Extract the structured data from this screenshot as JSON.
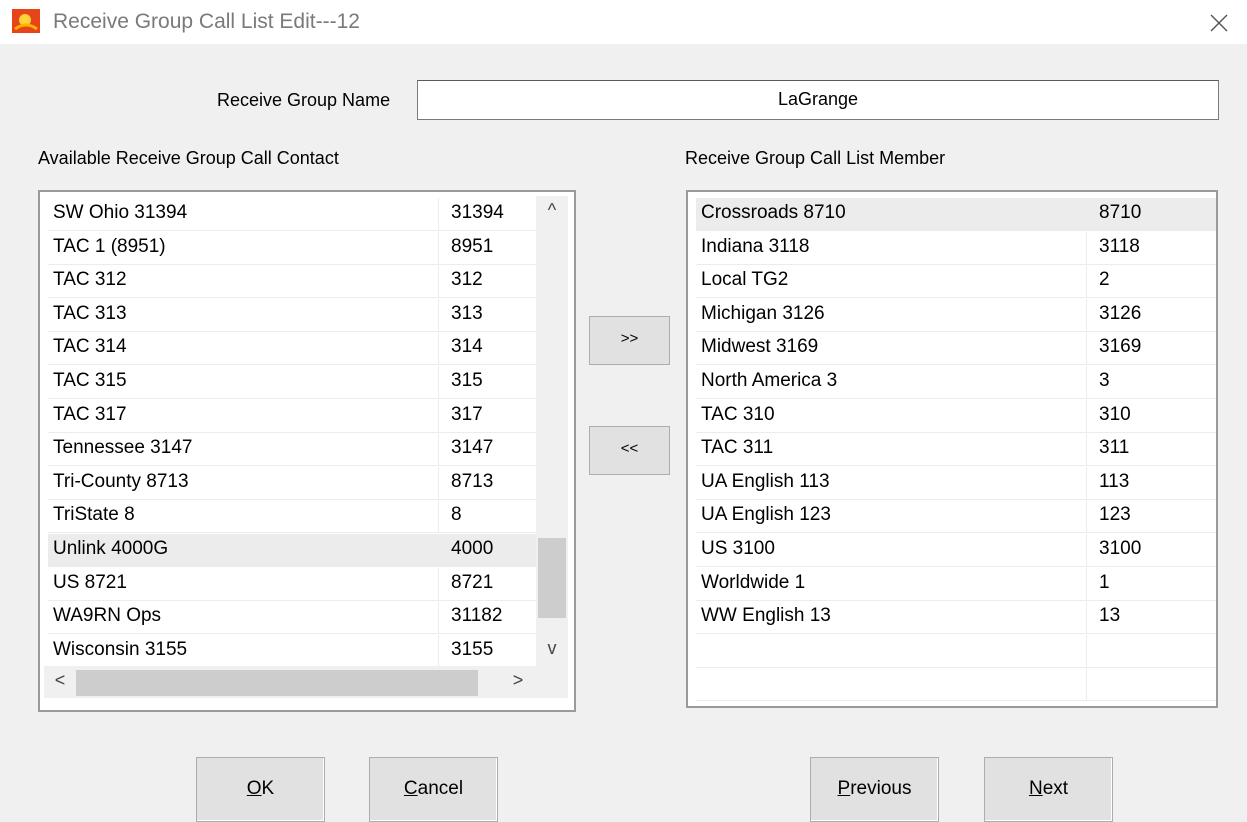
{
  "window": {
    "title": "Receive Group Call List Edit---12"
  },
  "name_field": {
    "label": "Receive Group Name",
    "value": "LaGrange"
  },
  "available": {
    "header": "Available Receive Group Call Contact",
    "rows": [
      {
        "name": "SW Ohio 31394",
        "id": "31394"
      },
      {
        "name": "TAC 1 (8951)",
        "id": "8951"
      },
      {
        "name": "TAC 312",
        "id": "312"
      },
      {
        "name": "TAC 313",
        "id": "313"
      },
      {
        "name": "TAC 314",
        "id": "314"
      },
      {
        "name": "TAC 315",
        "id": "315"
      },
      {
        "name": "TAC 317",
        "id": "317"
      },
      {
        "name": "Tennessee 3147",
        "id": "3147"
      },
      {
        "name": "Tri-County 8713",
        "id": "8713"
      },
      {
        "name": "TriState 8",
        "id": "8"
      },
      {
        "name": "Unlink 4000G",
        "id": "4000"
      },
      {
        "name": "US 8721",
        "id": "8721"
      },
      {
        "name": "WA9RN Ops",
        "id": "31182"
      },
      {
        "name": "Wisconsin 3155",
        "id": "3155"
      }
    ],
    "selected_index": 10
  },
  "members": {
    "header": "Receive Group Call List Member",
    "rows": [
      {
        "name": "Crossroads 8710",
        "id": "8710"
      },
      {
        "name": "Indiana 3118",
        "id": "3118"
      },
      {
        "name": "Local TG2",
        "id": "2"
      },
      {
        "name": "Michigan 3126",
        "id": "3126"
      },
      {
        "name": "Midwest 3169",
        "id": "3169"
      },
      {
        "name": "North America 3",
        "id": "3"
      },
      {
        "name": "TAC 310",
        "id": "310"
      },
      {
        "name": "TAC 311",
        "id": "311"
      },
      {
        "name": "UA English 113",
        "id": "113"
      },
      {
        "name": "UA English 123",
        "id": "123"
      },
      {
        "name": "US 3100",
        "id": "3100"
      },
      {
        "name": "Worldwide 1",
        "id": "1"
      },
      {
        "name": "WW English 13",
        "id": "13"
      },
      {
        "name": "",
        "id": ""
      },
      {
        "name": "",
        "id": ""
      }
    ],
    "selected_index": 0
  },
  "transfer": {
    "add_label": ">>",
    "remove_label": "<<"
  },
  "buttons": {
    "ok": {
      "mnemonic": "O",
      "rest": "K"
    },
    "cancel": {
      "mnemonic": "C",
      "rest": "ancel"
    },
    "previous": {
      "mnemonic": "P",
      "rest": "revious"
    },
    "next": {
      "mnemonic": "N",
      "rest": "ext"
    }
  },
  "scroll_glyphs": {
    "up": "^",
    "down": "v",
    "left": "<",
    "right": ">"
  }
}
